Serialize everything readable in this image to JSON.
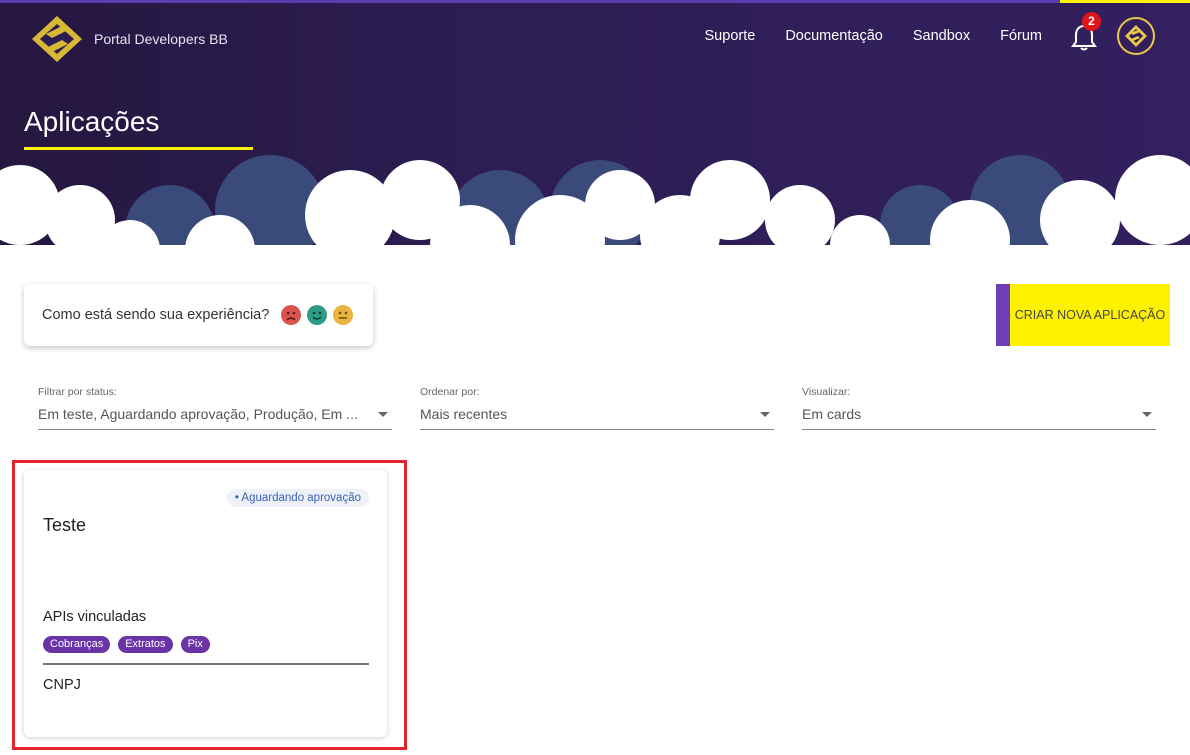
{
  "header": {
    "brand_name": "Portal Developers BB",
    "nav": [
      {
        "label": "Suporte"
      },
      {
        "label": "Documentação"
      },
      {
        "label": "Sandbox"
      },
      {
        "label": "Fórum"
      }
    ],
    "notifications_count": "2",
    "page_title": "Aplicações"
  },
  "feedback": {
    "question": "Como está sendo sua experiência?",
    "faces": [
      "sad-face-icon",
      "happy-face-icon",
      "neutral-face-icon"
    ]
  },
  "actions": {
    "create_label": "CRIAR NOVA APLICAÇÃO"
  },
  "filters": [
    {
      "label": "Filtrar por status:",
      "value": "Em teste, Aguardando aprovação, Produção, Em ..."
    },
    {
      "label": "Ordenar por:",
      "value": "Mais recentes"
    },
    {
      "label": "Visualizar:",
      "value": "Em cards"
    }
  ],
  "card": {
    "status": "• Aguardando aprovação",
    "title": "Teste",
    "apis_label": "APIs vinculadas",
    "apis": [
      "Cobranças",
      "Extratos",
      "Pix"
    ],
    "cnpj_label": "CNPJ"
  },
  "colors": {
    "accent_yellow": "#fff200",
    "accent_purple": "#6a33a8",
    "header_dark": "#25173f",
    "highlight_red": "#e3232b"
  }
}
